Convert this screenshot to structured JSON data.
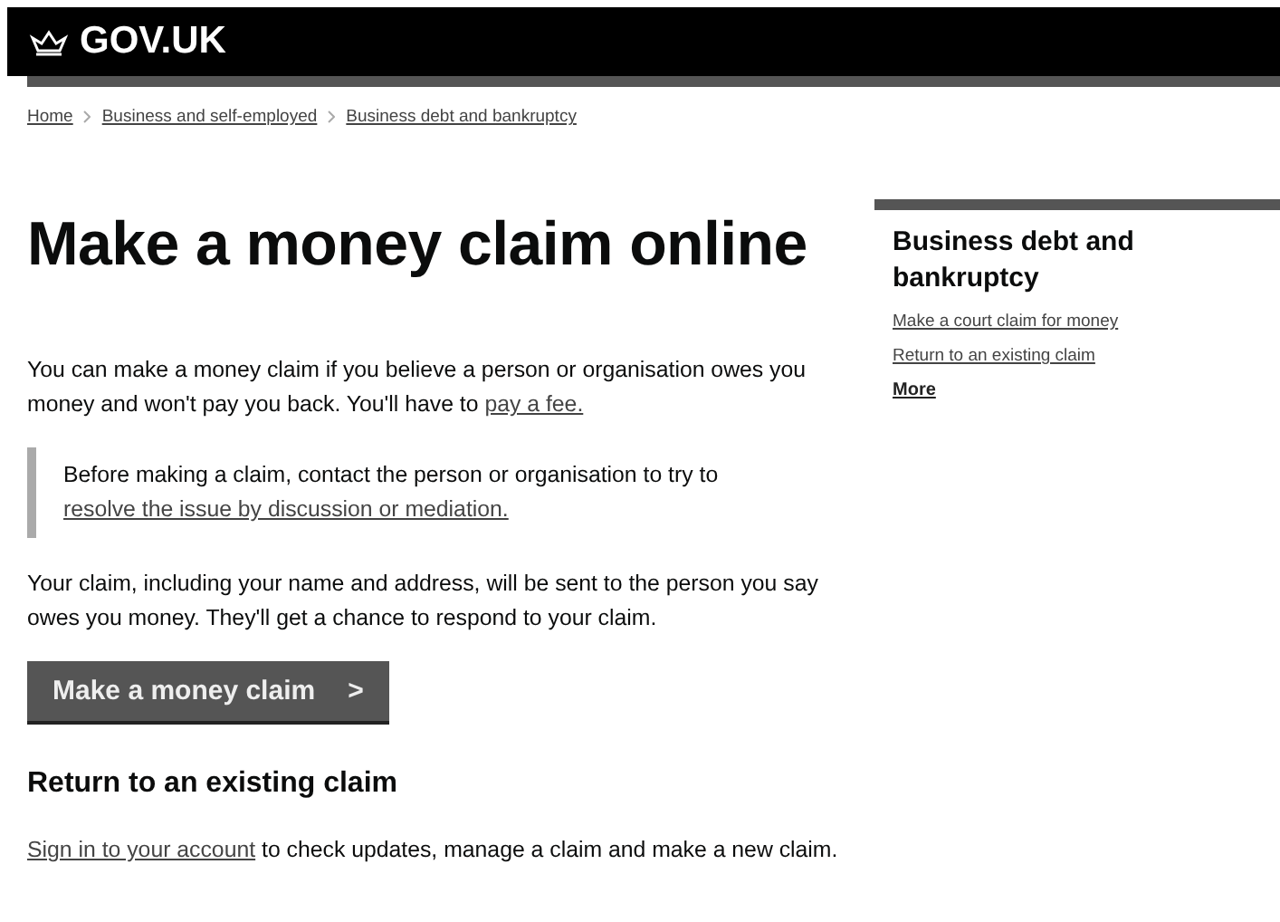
{
  "header": {
    "logo": "GOV.UK"
  },
  "breadcrumbs": [
    "Home",
    "Business and self-employed",
    "Business debt and bankruptcy"
  ],
  "title": "Make a money claim online",
  "intro": {
    "before": "You can make a money claim if you believe a person or organisation owes you money and won't pay you back. You'll have to ",
    "link": "pay a fee."
  },
  "inset": {
    "before": "Before making a claim, contact the person or organisation to try to ",
    "link": "resolve the issue by discussion or mediation."
  },
  "paragraph": "Your claim, including your name and address, will be sent to the person you say owes you money. They'll get a chance to respond to your claim.",
  "start_button": {
    "label": "Make a money claim",
    "icon": ">"
  },
  "return_section": {
    "heading": "Return to an existing claim",
    "link": "Sign in to your account",
    "after": " to check updates, manage a claim and make a new claim."
  },
  "sidebar": {
    "heading": "Business debt and bankruptcy",
    "links": [
      "Make a court claim for money",
      "Return to an existing claim"
    ],
    "more": "More"
  }
}
